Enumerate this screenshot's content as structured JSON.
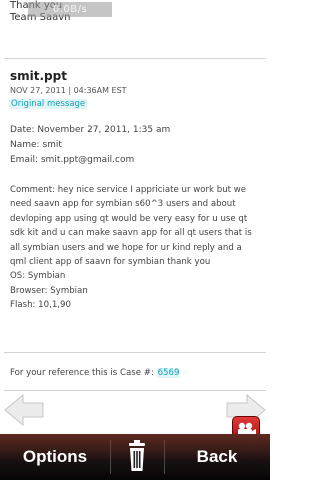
{
  "header": {
    "line1": "Thank you",
    "line2": "Team Saavn",
    "status_overlay": "0.0B/s"
  },
  "message": {
    "sender": "smit.ppt",
    "meta": "NOV 27, 2011 | 04:36AM EST",
    "original_link": "Original message",
    "date": "Date: November 27, 2011, 1:35 am",
    "name": "Name: smit",
    "email": "Email: smit.ppt@gmail.com",
    "comment_lines": [
      "Comment: hey nice service I appriciate ur work but we",
      "need saavn app for symbian s60^3 users and about",
      "devloping app using qt would be very easy for u use qt",
      "sdk kit and u can make saavn app for all qt users that is",
      "all symbian users and we hope for ur kind reply and a",
      "qml client app of saavn for symbian thank you",
      "OS: Symbian",
      "Browser: Symbian",
      "Flash: 10,1,90"
    ],
    "reference_text": "For your reference this is Case #:",
    "case_number": "6569"
  },
  "toolbar": {
    "options_label": "Options",
    "back_label": "Back"
  },
  "icons": {
    "delete": "trash-icon",
    "prev": "left-arrow-icon",
    "next": "right-arrow-icon",
    "video": "video-call-icon"
  },
  "colors": {
    "link": "#16a0b6",
    "toolbar": "#111111",
    "video_button": "#c41e1e"
  }
}
